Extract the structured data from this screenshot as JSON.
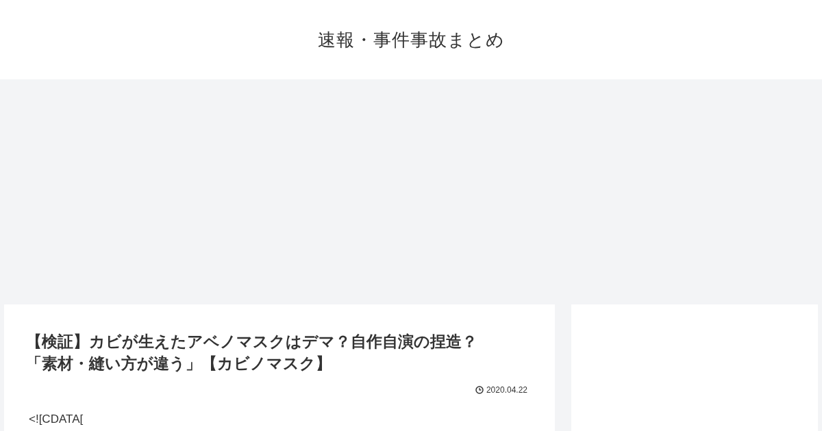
{
  "header": {
    "site_title": "速報・事件事故まとめ"
  },
  "article": {
    "title_lines": [
      "【検証】カビが生えたアベノマスクはデマ？自作自演の捏造？",
      "「素材・縫い方が違う」【カビノマスク】"
    ],
    "date": "2020.04.22",
    "body": "<![CDATA["
  }
}
